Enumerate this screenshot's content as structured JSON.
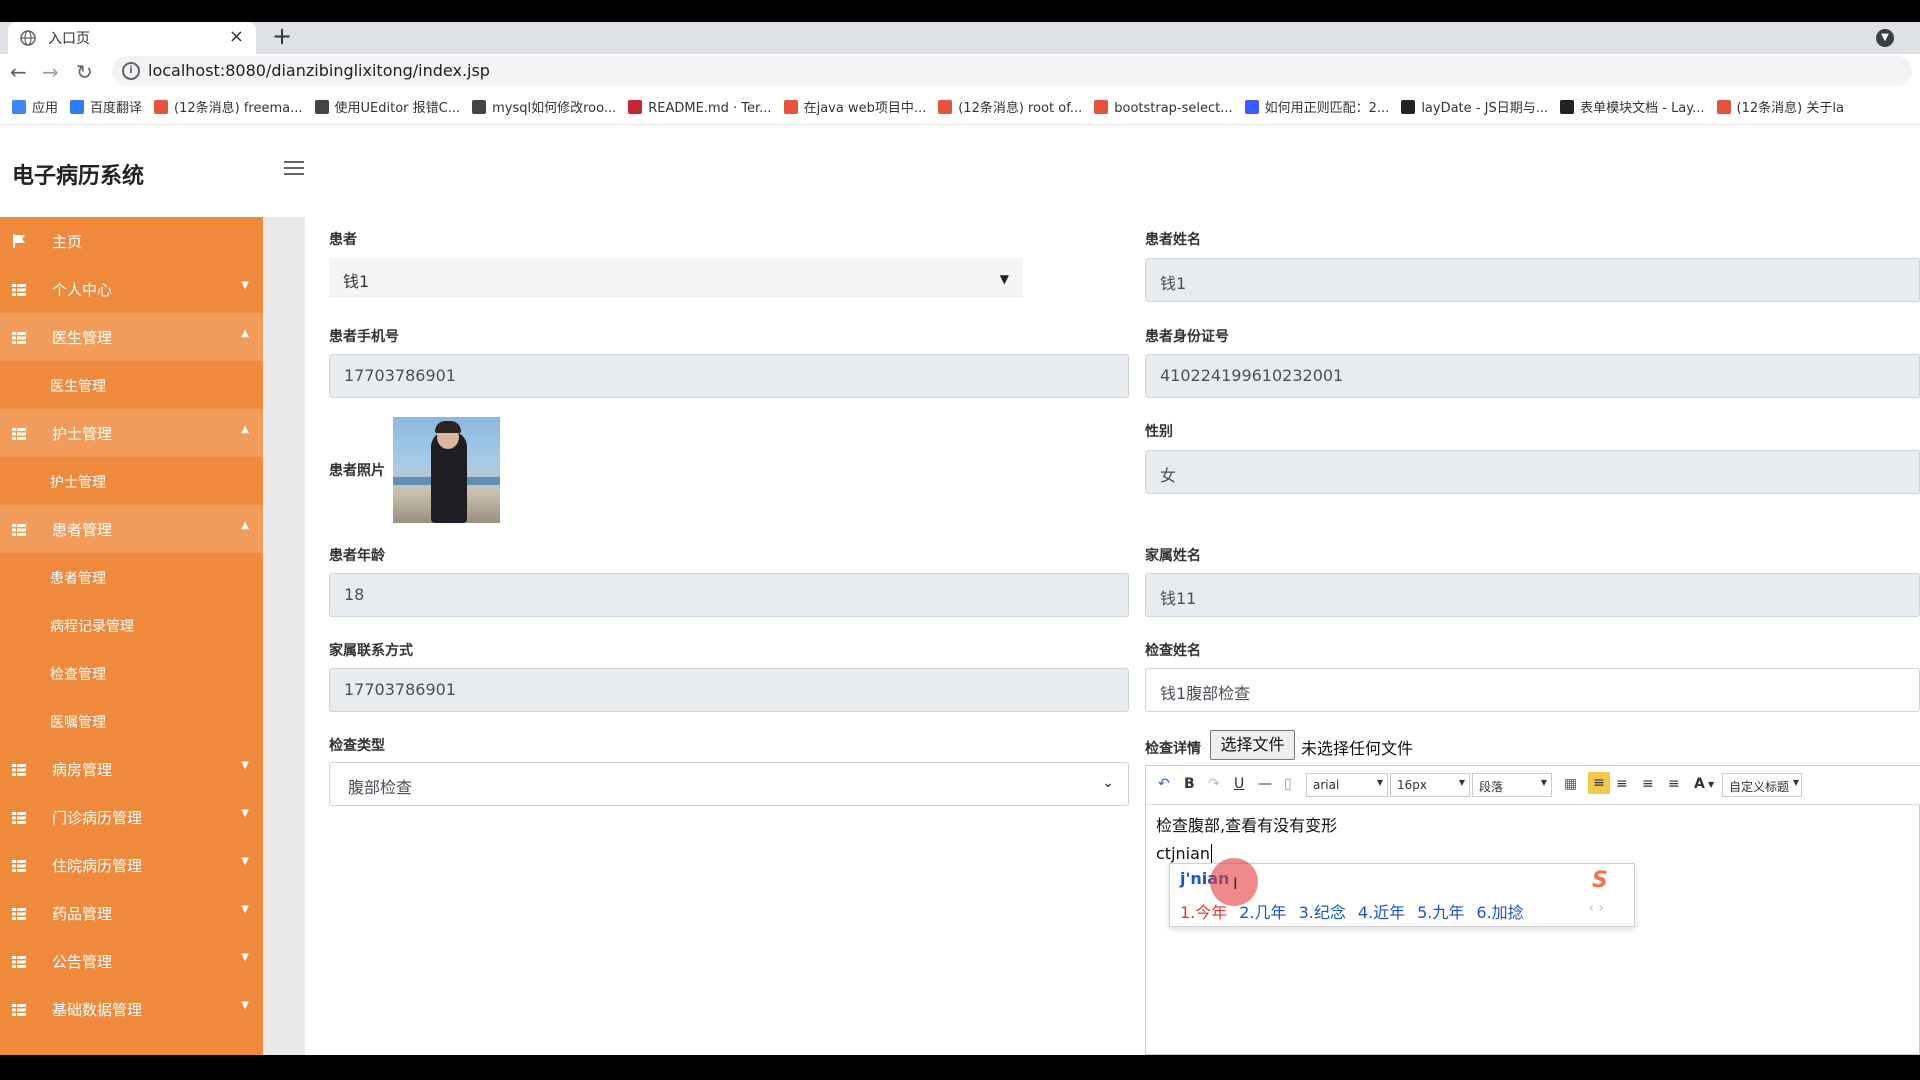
{
  "browser": {
    "tab_title": "入口页",
    "tab_close": "×",
    "new_tab": "+",
    "url": "localhost:8080/dianzibinglixitong/index.jsp",
    "bookmarks": [
      {
        "label": "应用",
        "color": "#4285f4"
      },
      {
        "label": "百度翻译",
        "color": "#2f7df6"
      },
      {
        "label": "(12条消息) freema...",
        "color": "#e5533c"
      },
      {
        "label": "使用UEditor 报错C...",
        "color": "#444444"
      },
      {
        "label": "mysql如何修改roo...",
        "color": "#444444"
      },
      {
        "label": "README.md · Ter...",
        "color": "#c7243a"
      },
      {
        "label": "在java web项目中...",
        "color": "#e5533c"
      },
      {
        "label": "(12条消息) root of...",
        "color": "#e5533c"
      },
      {
        "label": "bootstrap-select...",
        "color": "#e5533c"
      },
      {
        "label": "如何用正则匹配：2...",
        "color": "#3d5afe"
      },
      {
        "label": "layDate - JS日期与...",
        "color": "#222222"
      },
      {
        "label": "表单模块文档 - Lay...",
        "color": "#222222"
      },
      {
        "label": "(12条消息) 关于la",
        "color": "#e5533c"
      }
    ]
  },
  "app": {
    "brand": "电子病历系统",
    "accent": "#ef8a3d",
    "sidebar": [
      {
        "label": "主页",
        "type": "item",
        "icon": "flag-icon"
      },
      {
        "label": "个人中心",
        "type": "item",
        "icon": "grid-icon",
        "caret": "▼"
      },
      {
        "label": "医生管理",
        "type": "item-open",
        "icon": "grid-icon",
        "caret": "▲"
      },
      {
        "label": "医生管理",
        "type": "sub"
      },
      {
        "label": "护士管理",
        "type": "item-open",
        "icon": "grid-icon",
        "caret": "▲"
      },
      {
        "label": "护士管理",
        "type": "sub"
      },
      {
        "label": "患者管理",
        "type": "item-open",
        "icon": "grid-icon",
        "caret": "▲"
      },
      {
        "label": "患者管理",
        "type": "sub"
      },
      {
        "label": "病程记录管理",
        "type": "sub"
      },
      {
        "label": "检查管理",
        "type": "sub"
      },
      {
        "label": "医嘱管理",
        "type": "sub"
      },
      {
        "label": "病房管理",
        "type": "item",
        "icon": "grid-icon",
        "caret": "▼"
      },
      {
        "label": "门诊病历管理",
        "type": "item",
        "icon": "grid-icon",
        "caret": "▼"
      },
      {
        "label": "住院病历管理",
        "type": "item",
        "icon": "grid-icon",
        "caret": "▼"
      },
      {
        "label": "药品管理",
        "type": "item",
        "icon": "grid-icon",
        "caret": "▼"
      },
      {
        "label": "公告管理",
        "type": "item",
        "icon": "grid-icon",
        "caret": "▼"
      },
      {
        "label": "基础数据管理",
        "type": "item",
        "icon": "grid-icon",
        "caret": "▼"
      }
    ]
  },
  "form": {
    "patient_label": "患者",
    "patient_value": "钱1",
    "patient_name_label": "患者姓名",
    "patient_name_value": "钱1",
    "phone_label": "患者手机号",
    "phone_value": "17703786901",
    "idcard_label": "患者身份证号",
    "idcard_value": "410224199610232001",
    "photo_label": "患者照片",
    "gender_label": "性别",
    "gender_value": "女",
    "age_label": "患者年龄",
    "age_value": "18",
    "family_name_label": "家属姓名",
    "family_name_value": "钱11",
    "family_phone_label": "家属联系方式",
    "family_phone_value": "17703786901",
    "exam_name_label": "检查姓名",
    "exam_name_value": "钱1腹部检查",
    "exam_type_label": "检查类型",
    "exam_type_value": "腹部检查",
    "exam_detail_label": "检查详情",
    "file_button": "选择文件",
    "file_status": "未选择任何文件"
  },
  "editor": {
    "font": "arial",
    "size": "16px",
    "paragraph": "段落",
    "custom_title": "自定义标题",
    "line1": "检查腹部,查看有没有变形",
    "line2": "ctjnian",
    "bold": "B",
    "underline": "U",
    "fontcolor": "A"
  },
  "ime": {
    "composition": "j'nian",
    "candidates": [
      "1.今年",
      "2.几年",
      "3.纪念",
      "4.近年",
      "5.九年",
      "6.加捻"
    ],
    "arrows": "‹ ›"
  }
}
